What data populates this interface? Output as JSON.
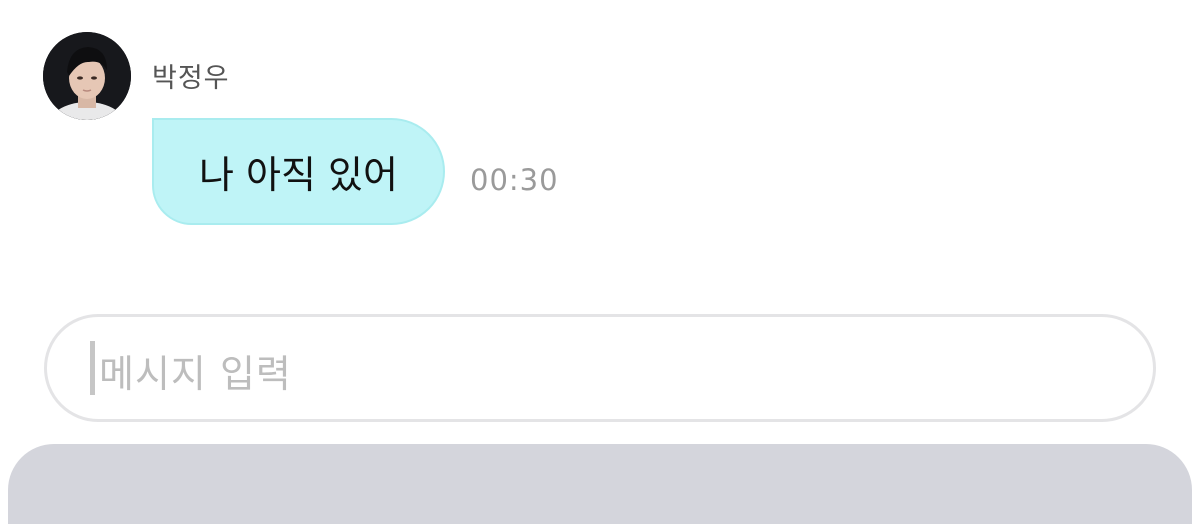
{
  "chat": {
    "sender_name": "박정우",
    "message_text": "나 아직 있어",
    "message_time": "00:30"
  },
  "input": {
    "placeholder": "메시지 입력"
  },
  "colors": {
    "bubble_bg": "#bff4f7",
    "bubble_border": "#a9ecef",
    "time_text": "#9a9a9a",
    "input_border": "#e4e4e6",
    "keyboard_bar": "#d4d5dc"
  },
  "icons": {
    "avatar": "profile-photo"
  }
}
